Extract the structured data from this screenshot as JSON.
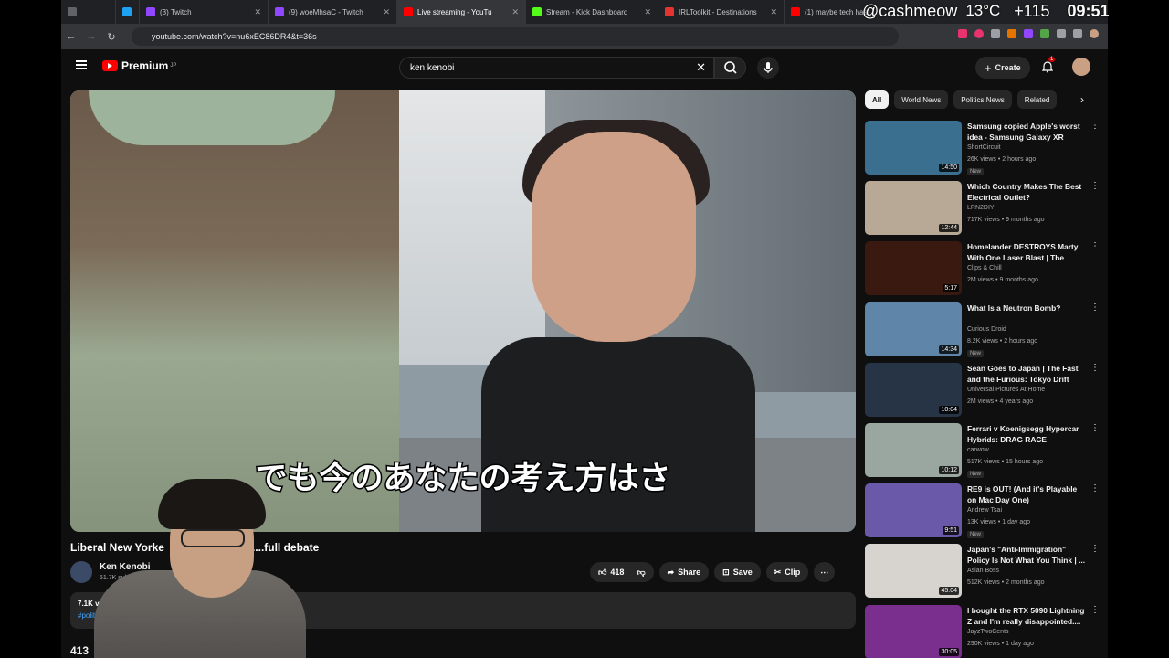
{
  "browser": {
    "tabs": [
      {
        "label": "",
        "color": "#5f6368"
      },
      {
        "label": "",
        "color": "#1da1f2"
      },
      {
        "label": "(3) Twitch",
        "color": "#9146ff"
      },
      {
        "label": "(9) woeMhsaC - Twitch",
        "color": "#9146ff"
      },
      {
        "label": "Live streaming - YouTu",
        "color": "#ff0000"
      },
      {
        "label": "Stream - Kick Dashboard",
        "color": "#53fc18"
      },
      {
        "label": "IRLToolkit - Destinations",
        "color": "#e3342f"
      },
      {
        "label": "(1) maybe tech has",
        "color": "#ff0000"
      }
    ],
    "url": "youtube.com/watch?v=nu6xEC86DR4&t=36s"
  },
  "overlay": {
    "handle": "@cashmeow",
    "temperature": "13°C",
    "count": "+115",
    "time": "09:51"
  },
  "youtube": {
    "logo": "Premium",
    "logo_region": "JP",
    "search_value": "ken kenobi",
    "create_label": "Create",
    "notification_count": "1"
  },
  "video": {
    "subtitle": "でも今のあなたの考え方はさ",
    "title": "Liberal New Yorke",
    "title_tail": "....full debate",
    "channel": "Ken Kenobi",
    "subscribers": "51.7K subse",
    "likes": "418",
    "share_label": "Share",
    "save_label": "Save",
    "clip_label": "Clip",
    "views": "7.1K view",
    "hashtag": "#politic",
    "comments_count": "413"
  },
  "chips": [
    "All",
    "World News",
    "Politics News",
    "Related"
  ],
  "recommendations": [
    {
      "title": "Samsung copied Apple's worst idea - Samsung Galaxy XR",
      "channel": "ShortCircuit",
      "meta": "26K views • 2 hours ago",
      "badge": "New",
      "duration": "14:50",
      "color": "#3a6f8f"
    },
    {
      "title": "Which Country Makes The Best Electrical Outlet?",
      "channel": "LRN2DIY",
      "meta": "717K views • 9 months ago",
      "badge": "",
      "duration": "12:44",
      "color": "#b8a896"
    },
    {
      "title": "Homelander DESTROYS Marty With One Laser Blast | The Boy...",
      "channel": "Clips & Chill",
      "meta": "2M views • 9 months ago",
      "badge": "",
      "duration": "5:17",
      "color": "#3a1a10"
    },
    {
      "title": "What Is a Neutron Bomb?",
      "channel": "Curious Droid",
      "meta": "8.2K views • 2 hours ago",
      "badge": "New",
      "duration": "14:34",
      "color": "#5f86a8"
    },
    {
      "title": "Sean Goes to Japan | The Fast and the Furious: Tokyo Drift",
      "channel": "Universal Pictures At Home",
      "meta": "2M views • 4 years ago",
      "badge": "",
      "duration": "10:04",
      "color": "#263445"
    },
    {
      "title": "Ferrari v Koenigsegg Hypercar Hybrids: DRAG RACE",
      "channel": "carwow",
      "meta": "517K views • 15 hours ago",
      "badge": "New",
      "duration": "10:12",
      "color": "#9aa7a0"
    },
    {
      "title": "RE9 is OUT! (And it's Playable on Mac Day One)",
      "channel": "Andrew Tsai",
      "meta": "13K views • 1 day ago",
      "badge": "New",
      "duration": "9:51",
      "color": "#6a58a8"
    },
    {
      "title": "Japan's \"Anti-Immigration\" Policy Is Not What You Think | ...",
      "channel": "Asian Boss",
      "meta": "512K views • 2 months ago",
      "badge": "",
      "duration": "45:04",
      "color": "#d7d4cf"
    },
    {
      "title": "I bought the RTX 5090 Lightning Z and I'm really disappointed....",
      "channel": "JayzTwoCents",
      "meta": "290K views • 1 day ago",
      "badge": "",
      "duration": "30:05",
      "color": "#7a2f8f"
    }
  ]
}
